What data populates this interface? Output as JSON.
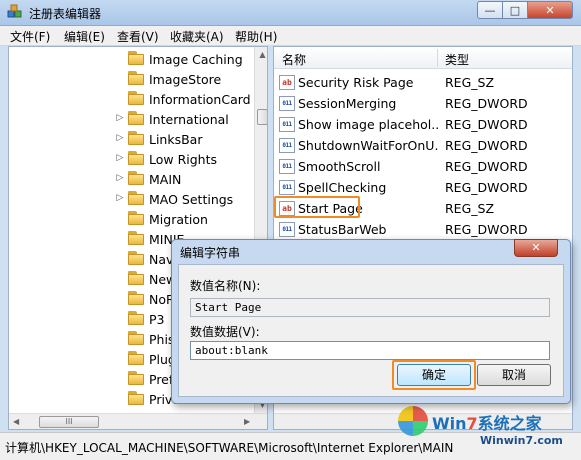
{
  "window": {
    "title": "注册表编辑器",
    "controls": {
      "minimize": "—",
      "maximize": "□",
      "close": "✕"
    }
  },
  "menu": [
    {
      "label": "文件(F)"
    },
    {
      "label": "编辑(E)"
    },
    {
      "label": "查看(V)"
    },
    {
      "label": "收藏夹(A)"
    },
    {
      "label": "帮助(H)"
    }
  ],
  "tree": {
    "items": [
      {
        "label": "Image Caching",
        "expandable": false
      },
      {
        "label": "ImageStore",
        "expandable": false
      },
      {
        "label": "InformationCard T",
        "expandable": false
      },
      {
        "label": "International",
        "expandable": true
      },
      {
        "label": "LinksBar",
        "expandable": true
      },
      {
        "label": "Low Rights",
        "expandable": true
      },
      {
        "label": "MAIN",
        "expandable": true,
        "selected": true
      },
      {
        "label": "MAO Settings",
        "expandable": true
      },
      {
        "label": "Migration",
        "expandable": false
      },
      {
        "label": "MINIE",
        "expandable": false
      },
      {
        "label": "Navi",
        "expandable": false
      },
      {
        "label": "New",
        "expandable": false
      },
      {
        "label": "NoR",
        "expandable": false
      },
      {
        "label": "P3",
        "expandable": false
      },
      {
        "label": "Phisl",
        "expandable": false
      },
      {
        "label": "Plug",
        "expandable": false
      },
      {
        "label": "Prefe",
        "expandable": false
      },
      {
        "label": "Priva",
        "expandable": false
      }
    ]
  },
  "list": {
    "headers": {
      "name": "名称",
      "type": "类型"
    },
    "rows": [
      {
        "name": "Security Risk Page",
        "type": "REG_SZ",
        "icon": "string-value-icon"
      },
      {
        "name": "SessionMerging",
        "type": "REG_DWORD",
        "icon": "dword-value-icon"
      },
      {
        "name": "Show image placehol...",
        "type": "REG_DWORD",
        "icon": "dword-value-icon"
      },
      {
        "name": "ShutdownWaitForOnU...",
        "type": "REG_DWORD",
        "icon": "dword-value-icon"
      },
      {
        "name": "SmoothScroll",
        "type": "REG_DWORD",
        "icon": "dword-value-icon"
      },
      {
        "name": "SpellChecking",
        "type": "REG_DWORD",
        "icon": "dword-value-icon"
      },
      {
        "name": "Start Page",
        "type": "REG_SZ",
        "icon": "string-value-icon",
        "highlighted": true
      },
      {
        "name": "StatusBarWeb",
        "type": "REG_DWORD",
        "icon": "dword-value-icon"
      }
    ],
    "icon_glyphs": {
      "sz": "ab",
      "dword": "011"
    }
  },
  "status": {
    "path": "计算机\\HKEY_LOCAL_MACHINE\\SOFTWARE\\Microsoft\\Internet Explorer\\MAIN"
  },
  "dialog": {
    "title": "编辑字符串",
    "close": "✕",
    "name_label": "数值名称(N):",
    "name_value": "Start Page",
    "data_label": "数值数据(V):",
    "data_value": "about:blank",
    "ok": "确定",
    "cancel": "取消"
  },
  "watermark": {
    "brand_prefix": "Win",
    "brand_seven": "7",
    "brand_suffix": "系统之家",
    "url": "Winwin7.com"
  },
  "colors": {
    "highlight_outline": "#f08c25",
    "titlebar": "#aac6e8"
  }
}
